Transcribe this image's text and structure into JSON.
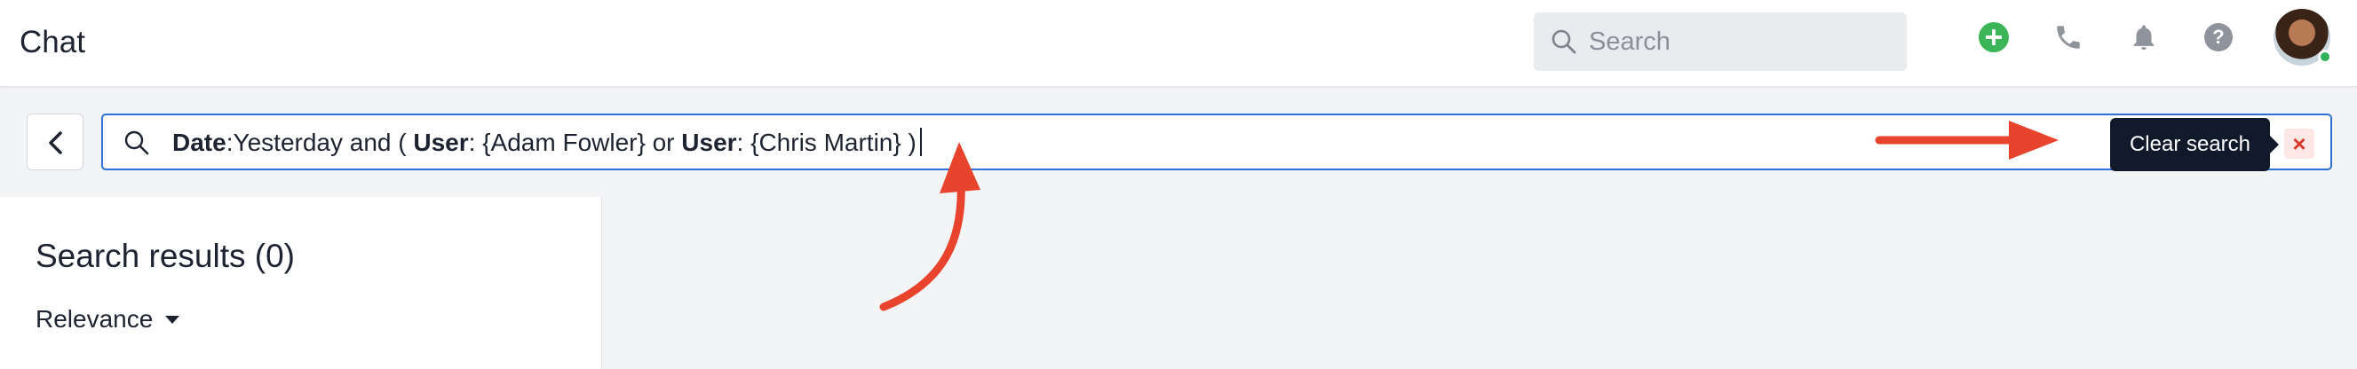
{
  "header": {
    "app_title": "Chat",
    "search_placeholder": "Search",
    "icons": [
      "search-icon",
      "plus-icon",
      "phone-icon",
      "bell-icon",
      "help-icon"
    ],
    "add_color": "#3bb557"
  },
  "search_bar": {
    "query_parts": [
      {
        "text": "Date",
        "bold": true
      },
      {
        "text": ":Yesterday and ( ",
        "bold": false
      },
      {
        "text": "User",
        "bold": true
      },
      {
        "text": ": {Adam Fowler} or ",
        "bold": false
      },
      {
        "text": "User",
        "bold": true
      },
      {
        "text": ": {Chris Martin} )",
        "bold": false
      }
    ],
    "clear_tooltip": "Clear search",
    "clear_symbol": "×",
    "accent_color": "#2f6fd6"
  },
  "results": {
    "title": "Search results (0)",
    "sort_label": "Relevance"
  },
  "annotation_color": "#e8432c"
}
